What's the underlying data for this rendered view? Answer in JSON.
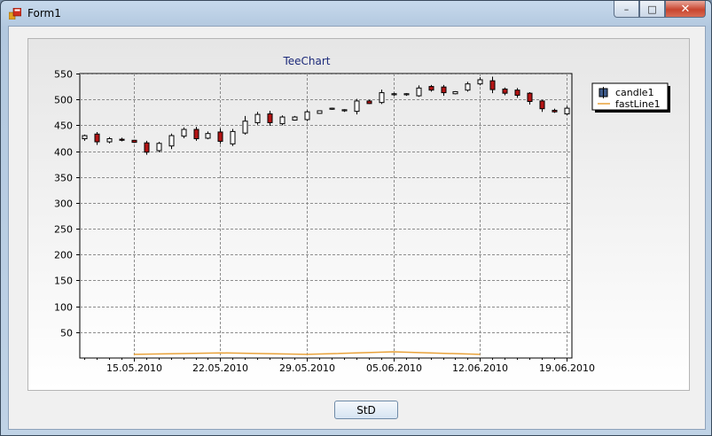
{
  "window": {
    "title": "Form1",
    "minimize_symbol": "–",
    "maximize_symbol": "□",
    "close_symbol": "✕"
  },
  "button": {
    "label": "StD"
  },
  "colors": {
    "up_fill": "#ffffff",
    "down_fill": "#b41414",
    "fastline": "#e8a23a",
    "title": "#1c2a7a"
  },
  "chart_data": {
    "type": "candlestick",
    "title": "TeeChart",
    "ylim": [
      0,
      550
    ],
    "yticks": [
      50,
      100,
      150,
      200,
      250,
      300,
      350,
      400,
      450,
      500,
      550
    ],
    "xticks": [
      "15.05.2010",
      "22.05.2010",
      "29.05.2010",
      "05.06.2010",
      "12.06.2010",
      "19.06.2010"
    ],
    "grid": true,
    "legend_position": "right",
    "legend": [
      "candle1",
      "fastLine1"
    ],
    "candles": [
      {
        "date": "11.05.2010",
        "open": 424,
        "high": 432,
        "low": 420,
        "close": 430
      },
      {
        "date": "12.05.2010",
        "open": 433,
        "high": 437,
        "low": 412,
        "close": 418
      },
      {
        "date": "13.05.2010",
        "open": 418,
        "high": 427,
        "low": 415,
        "close": 424
      },
      {
        "date": "14.05.2010",
        "open": 423,
        "high": 426,
        "low": 419,
        "close": 421
      },
      {
        "date": "15.05.2010",
        "open": 421,
        "high": 422,
        "low": 416,
        "close": 417
      },
      {
        "date": "16.05.2010",
        "open": 416,
        "high": 420,
        "low": 393,
        "close": 398
      },
      {
        "date": "17.05.2010",
        "open": 401,
        "high": 418,
        "low": 398,
        "close": 415
      },
      {
        "date": "18.05.2010",
        "open": 410,
        "high": 434,
        "low": 404,
        "close": 430
      },
      {
        "date": "19.05.2010",
        "open": 429,
        "high": 446,
        "low": 425,
        "close": 442
      },
      {
        "date": "20.05.2010",
        "open": 442,
        "high": 447,
        "low": 420,
        "close": 424
      },
      {
        "date": "21.05.2010",
        "open": 425,
        "high": 438,
        "low": 423,
        "close": 434
      },
      {
        "date": "22.05.2010",
        "open": 437,
        "high": 444,
        "low": 414,
        "close": 419
      },
      {
        "date": "23.05.2010",
        "open": 414,
        "high": 443,
        "low": 410,
        "close": 438
      },
      {
        "date": "24.05.2010",
        "open": 435,
        "high": 468,
        "low": 432,
        "close": 458
      },
      {
        "date": "25.05.2010",
        "open": 455,
        "high": 476,
        "low": 451,
        "close": 471
      },
      {
        "date": "26.05.2010",
        "open": 472,
        "high": 478,
        "low": 449,
        "close": 455
      },
      {
        "date": "27.05.2010",
        "open": 453,
        "high": 469,
        "low": 450,
        "close": 466
      },
      {
        "date": "28.05.2010",
        "open": 460,
        "high": 468,
        "low": 459,
        "close": 466
      },
      {
        "date": "29.05.2010",
        "open": 461,
        "high": 479,
        "low": 458,
        "close": 476
      },
      {
        "date": "30.05.2010",
        "open": 473,
        "high": 479,
        "low": 472,
        "close": 478
      },
      {
        "date": "31.05.2010",
        "open": 481,
        "high": 484,
        "low": 480,
        "close": 483
      },
      {
        "date": "01.06.2010",
        "open": 478,
        "high": 481,
        "low": 476,
        "close": 480
      },
      {
        "date": "02.06.2010",
        "open": 477,
        "high": 501,
        "low": 471,
        "close": 497
      },
      {
        "date": "03.06.2010",
        "open": 497,
        "high": 499,
        "low": 491,
        "close": 492
      },
      {
        "date": "04.06.2010",
        "open": 494,
        "high": 519,
        "low": 491,
        "close": 513
      },
      {
        "date": "05.06.2010",
        "open": 509,
        "high": 513,
        "low": 507,
        "close": 511
      },
      {
        "date": "06.06.2010",
        "open": 509,
        "high": 512,
        "low": 507,
        "close": 511
      },
      {
        "date": "07.06.2010",
        "open": 507,
        "high": 527,
        "low": 505,
        "close": 522
      },
      {
        "date": "08.06.2010",
        "open": 525,
        "high": 528,
        "low": 515,
        "close": 518
      },
      {
        "date": "09.06.2010",
        "open": 524,
        "high": 528,
        "low": 507,
        "close": 513
      },
      {
        "date": "10.06.2010",
        "open": 511,
        "high": 516,
        "low": 510,
        "close": 515
      },
      {
        "date": "11.06.2010",
        "open": 518,
        "high": 534,
        "low": 515,
        "close": 530
      },
      {
        "date": "12.06.2010",
        "open": 530,
        "high": 543,
        "low": 527,
        "close": 538
      },
      {
        "date": "13.06.2010",
        "open": 536,
        "high": 544,
        "low": 512,
        "close": 519
      },
      {
        "date": "14.06.2010",
        "open": 520,
        "high": 523,
        "low": 508,
        "close": 512
      },
      {
        "date": "15.06.2010",
        "open": 518,
        "high": 522,
        "low": 503,
        "close": 508
      },
      {
        "date": "16.06.2010",
        "open": 512,
        "high": 514,
        "low": 490,
        "close": 496
      },
      {
        "date": "17.06.2010",
        "open": 497,
        "high": 499,
        "low": 476,
        "close": 482
      },
      {
        "date": "18.06.2010",
        "open": 479,
        "high": 482,
        "low": 474,
        "close": 476
      },
      {
        "date": "19.06.2010",
        "open": 472,
        "high": 487,
        "low": 470,
        "close": 483
      }
    ],
    "fastline": [
      {
        "date": "15.05.2010",
        "value": 7
      },
      {
        "date": "22.05.2010",
        "value": 10
      },
      {
        "date": "29.05.2010",
        "value": 7
      },
      {
        "date": "05.06.2010",
        "value": 12
      },
      {
        "date": "12.06.2010",
        "value": 7
      }
    ]
  }
}
